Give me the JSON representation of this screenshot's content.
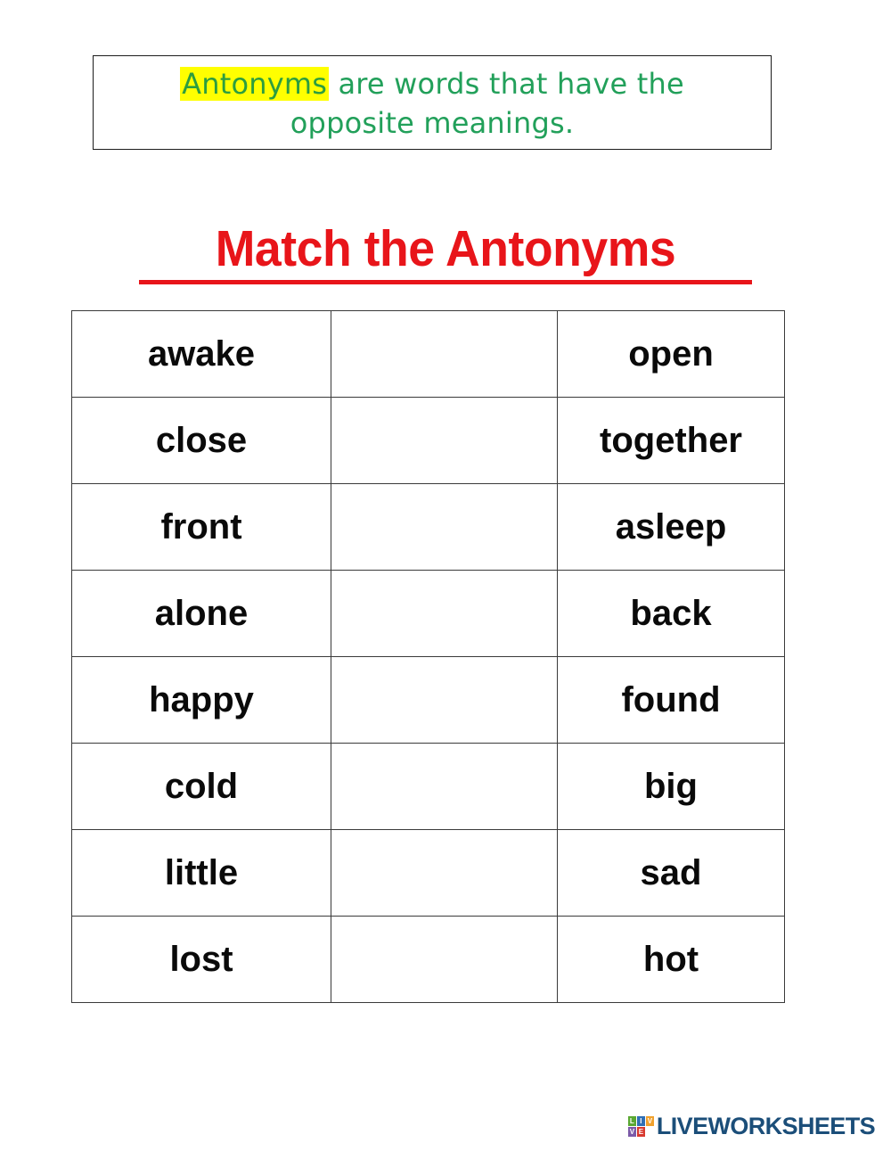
{
  "definition": {
    "highlighted_word": "Antonyms",
    "line1_rest": " are words that have the",
    "line2": "opposite meanings.",
    "text_color": "#22a05a",
    "highlight_color": "#ffff00"
  },
  "title": {
    "text": "Match the Antonyms",
    "color": "#e8151a"
  },
  "table": {
    "rows": [
      {
        "left": "awake",
        "middle": "",
        "right": "open"
      },
      {
        "left": "close",
        "middle": "",
        "right": "together"
      },
      {
        "left": "front",
        "middle": "",
        "right": "asleep"
      },
      {
        "left": "alone",
        "middle": "",
        "right": "back"
      },
      {
        "left": "happy",
        "middle": "",
        "right": "found"
      },
      {
        "left": "cold",
        "middle": "",
        "right": "big"
      },
      {
        "left": "little",
        "middle": "",
        "right": "sad"
      },
      {
        "left": "lost",
        "middle": "",
        "right": "hot"
      }
    ]
  },
  "footer": {
    "brand": "LIVEWORKSHEETS",
    "brand_color": "#1b4e79",
    "tiles": [
      {
        "letter": "L",
        "color": "#5aa832"
      },
      {
        "letter": "I",
        "color": "#2f6fb5"
      },
      {
        "letter": "V",
        "color": "#f0a12e"
      },
      {
        "letter": "V",
        "color": "#7b5aa8"
      },
      {
        "letter": "E",
        "color": "#d8392f"
      },
      {
        "letter": "",
        "color": "transparent"
      }
    ]
  }
}
